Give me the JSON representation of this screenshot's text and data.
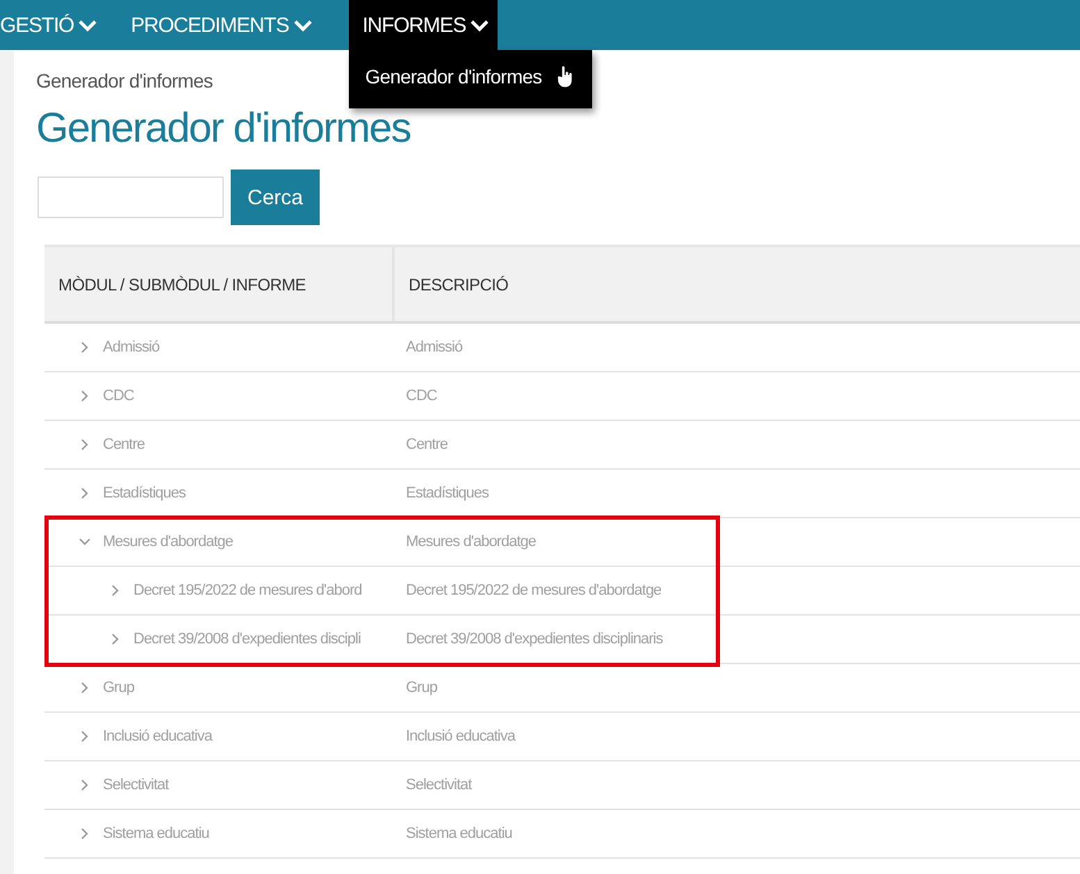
{
  "nav": [
    {
      "label": "GESTIÓ",
      "selected": false
    },
    {
      "label": "PROCEDIMENTS",
      "selected": false
    },
    {
      "label": "INFORMES",
      "selected": true,
      "menu": [
        "Generador d'informes"
      ]
    }
  ],
  "breadcrumb": "Generador d'informes",
  "title": "Generador d'informes",
  "search": {
    "button": "Cerca"
  },
  "table": {
    "columns": [
      "MÒDUL / SUBMÒDUL / INFORME",
      "DESCRIPCIÓ"
    ],
    "rows": [
      {
        "module": "Admissió",
        "description": "Admissió",
        "expanded": false
      },
      {
        "module": "CDC",
        "description": "CDC",
        "expanded": false
      },
      {
        "module": "Centre",
        "description": "Centre",
        "expanded": false
      },
      {
        "module": "Estadístiques",
        "description": "Estadístiques",
        "expanded": false
      },
      {
        "module": "Mesures d'abordatge",
        "description": "Mesures d'abordatge",
        "expanded": true,
        "highlighted": true,
        "children": [
          {
            "module": "Decret 195/2022 de mesures d'abord",
            "description": "Decret 195/2022 de mesures d'abordatge",
            "expanded": false
          },
          {
            "module": "Decret 39/2008 d'expedientes discipli",
            "description": "Decret 39/2008 d'expedientes disciplinaris",
            "expanded": false
          }
        ]
      },
      {
        "module": "Grup",
        "description": "Grup",
        "expanded": false
      },
      {
        "module": "Inclusió educativa",
        "description": "Inclusió educativa",
        "expanded": false
      },
      {
        "module": "Selectivitat",
        "description": "Selectivitat",
        "expanded": false
      },
      {
        "module": "Sistema educatiu",
        "description": "Sistema educatiu",
        "expanded": false
      }
    ]
  }
}
